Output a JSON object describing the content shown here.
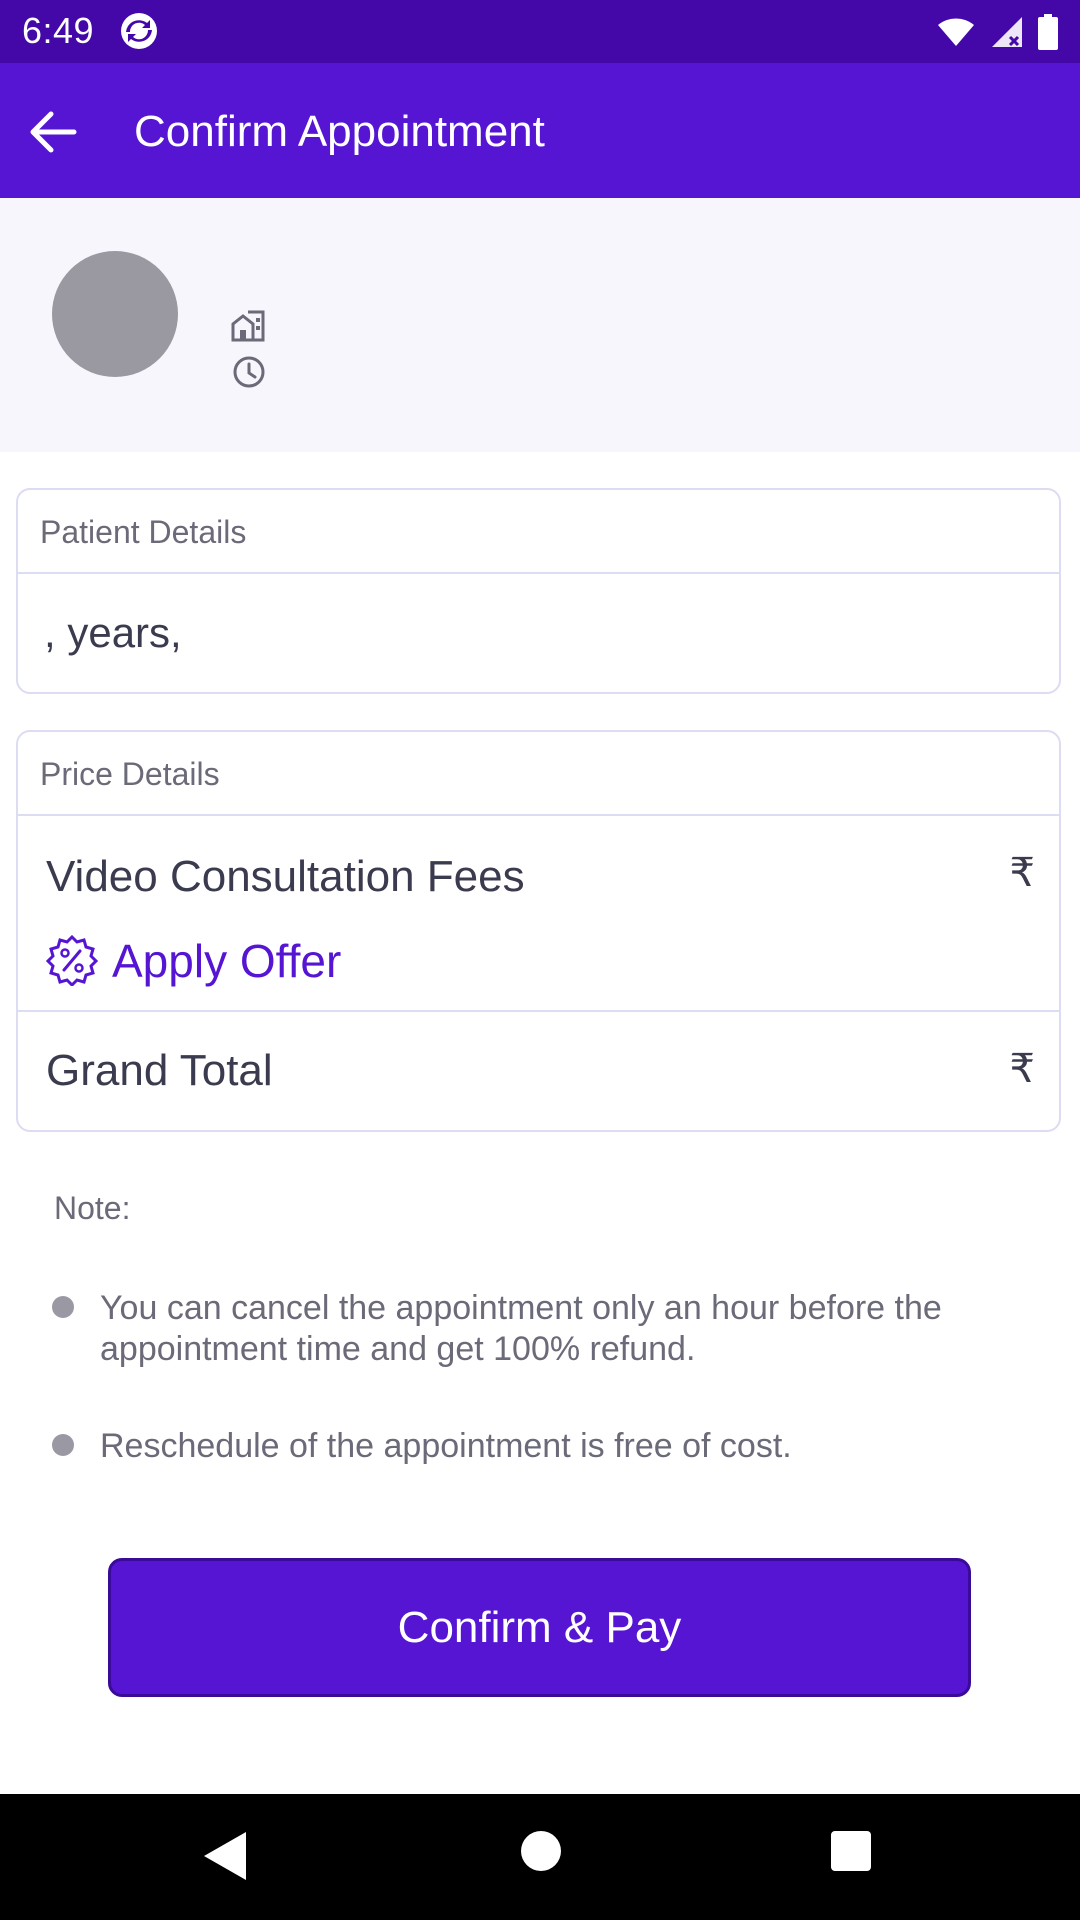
{
  "status_bar": {
    "time": "6:49"
  },
  "app_bar": {
    "title": "Confirm Appointment"
  },
  "patient_details": {
    "header": "Patient Details",
    "summary": ",  years,"
  },
  "price_details": {
    "header": "Price Details",
    "fee_label": "Video Consultation Fees",
    "fee_currency": "₹",
    "apply_offer": "Apply Offer",
    "total_label": "Grand Total",
    "total_currency": "₹"
  },
  "note": {
    "title": "Note:",
    "items": [
      "You can cancel the appointment only an hour before the appointment time and get 100% refund.",
      "Reschedule of the appointment is free of cost."
    ]
  },
  "actions": {
    "confirm_label": "Confirm & Pay"
  },
  "colors": {
    "primary": "#5515d2",
    "status_bar": "#4407a8",
    "panel_bg": "#f8f6fd",
    "border": "#dcdcf2"
  }
}
